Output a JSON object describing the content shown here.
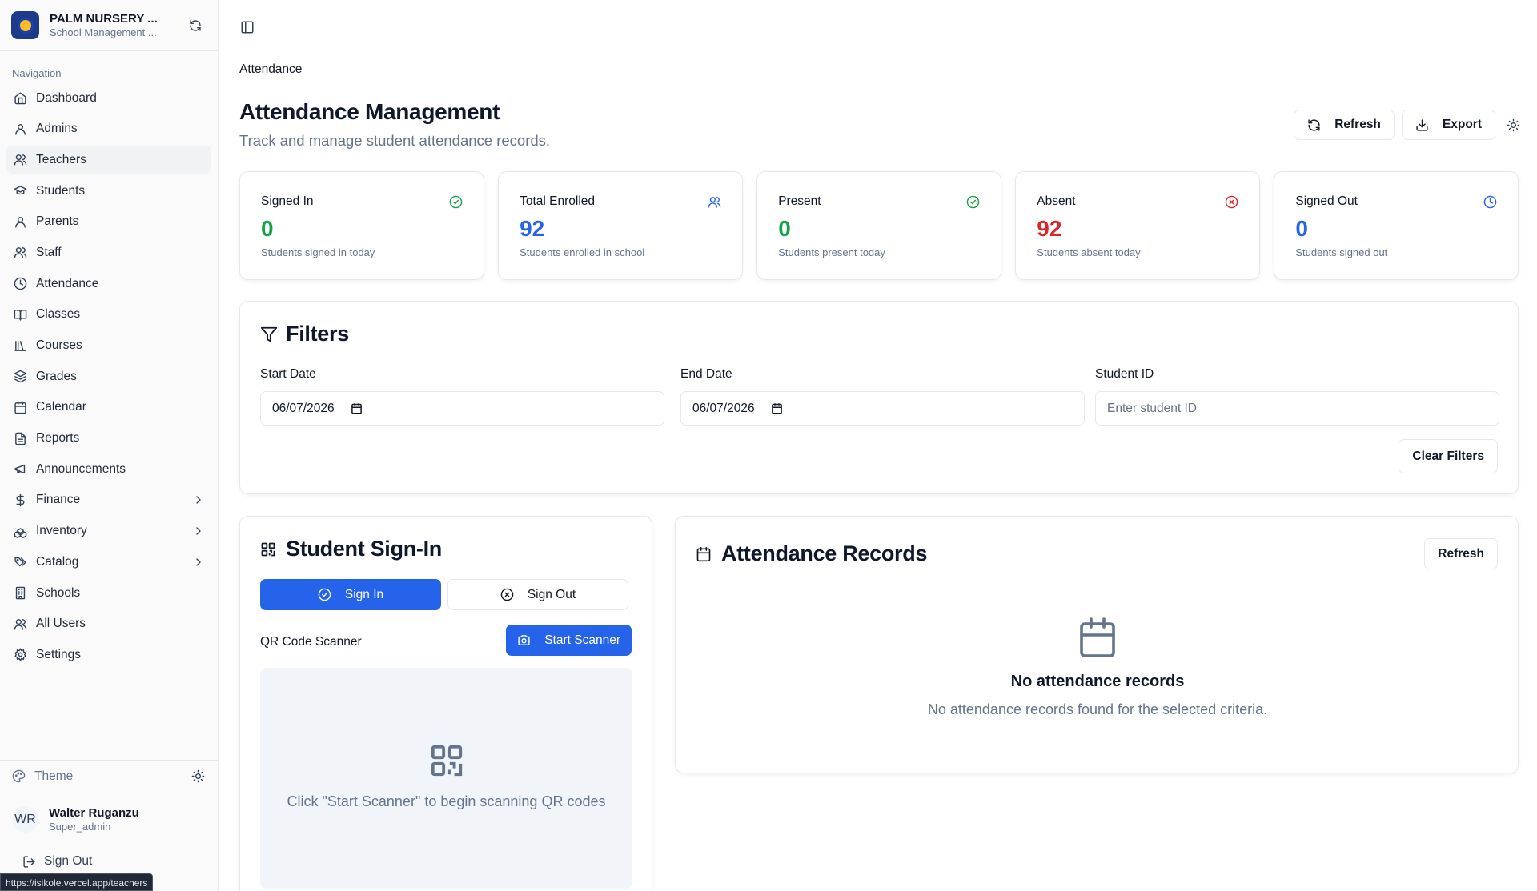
{
  "brand": {
    "name": "PALM NURSERY ...",
    "subtitle": "School Management ..."
  },
  "nav": {
    "title": "Navigation",
    "items": [
      {
        "label": "Dashboard",
        "icon": "home-icon"
      },
      {
        "label": "Admins",
        "icon": "user-icon"
      },
      {
        "label": "Teachers",
        "icon": "users-icon",
        "active": true
      },
      {
        "label": "Students",
        "icon": "graduation-cap-icon"
      },
      {
        "label": "Parents",
        "icon": "user-icon"
      },
      {
        "label": "Staff",
        "icon": "users-icon"
      },
      {
        "label": "Attendance",
        "icon": "clock-icon"
      },
      {
        "label": "Classes",
        "icon": "book-open-icon"
      },
      {
        "label": "Courses",
        "icon": "library-icon"
      },
      {
        "label": "Grades",
        "icon": "layers-icon"
      },
      {
        "label": "Calendar",
        "icon": "calendar-icon"
      },
      {
        "label": "Reports",
        "icon": "file-text-icon"
      },
      {
        "label": "Announcements",
        "icon": "megaphone-icon"
      },
      {
        "label": "Finance",
        "icon": "dollar-icon",
        "expandable": true
      },
      {
        "label": "Inventory",
        "icon": "boxes-icon",
        "expandable": true
      },
      {
        "label": "Catalog",
        "icon": "tags-icon",
        "expandable": true
      },
      {
        "label": "Schools",
        "icon": "building-icon"
      },
      {
        "label": "All Users",
        "icon": "users-icon"
      },
      {
        "label": "Settings",
        "icon": "gear-icon"
      }
    ]
  },
  "sidebar_footer": {
    "theme_label": "Theme",
    "user": {
      "initials": "WR",
      "name": "Walter Ruganzu",
      "role": "Super_admin"
    },
    "signout_label": "Sign Out"
  },
  "status_url": "https://isikole.vercel.app/teachers",
  "header": {
    "breadcrumb": "Attendance",
    "title": "Attendance Management",
    "subtitle": "Track and manage student attendance records.",
    "refresh_label": "Refresh",
    "export_label": "Export"
  },
  "stats": [
    {
      "title": "Signed In",
      "value": "0",
      "note": "Students signed in today",
      "color": "#16a34a",
      "icon": "check-circle-icon"
    },
    {
      "title": "Total Enrolled",
      "value": "92",
      "note": "Students enrolled in school",
      "color": "#2563eb",
      "icon": "users-icon"
    },
    {
      "title": "Present",
      "value": "0",
      "note": "Students present today",
      "color": "#16a34a",
      "icon": "check-circle-icon"
    },
    {
      "title": "Absent",
      "value": "92",
      "note": "Students absent today",
      "color": "#dc2626",
      "icon": "x-circle-icon"
    },
    {
      "title": "Signed Out",
      "value": "0",
      "note": "Students signed out",
      "color": "#2563eb",
      "icon": "clock-icon"
    }
  ],
  "filters": {
    "title": "Filters",
    "start_date": {
      "label": "Start Date",
      "value": "06/07/2026"
    },
    "end_date": {
      "label": "End Date",
      "value": "06/07/2026"
    },
    "student_id": {
      "label": "Student ID",
      "placeholder": "Enter student ID"
    },
    "clear_label": "Clear Filters"
  },
  "signin": {
    "title": "Student Sign-In",
    "sign_in_label": "Sign In",
    "sign_out_label": "Sign Out",
    "qr_label": "QR Code Scanner",
    "start_scanner_label": "Start Scanner",
    "scanner_hint": "Click \"Start Scanner\" to begin scanning QR codes"
  },
  "records": {
    "title": "Attendance Records",
    "refresh_label": "Refresh",
    "empty_title": "No attendance records",
    "empty_sub": "No attendance records found for the selected criteria."
  },
  "colors": {
    "accent": "#2563eb",
    "success": "#16a34a",
    "danger": "#dc2626"
  }
}
